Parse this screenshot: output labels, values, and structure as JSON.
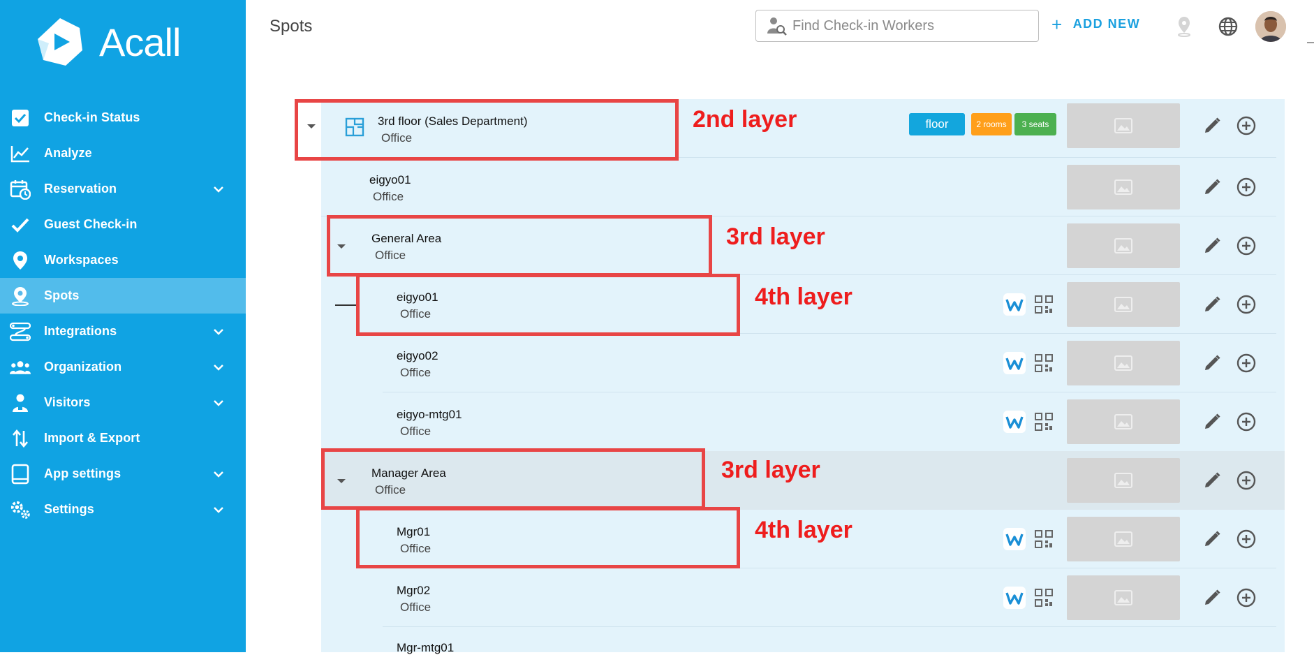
{
  "app": {
    "logo_text": "Acall"
  },
  "sidebar": {
    "items": [
      {
        "label": "Check-in Status",
        "icon": "checkbox-icon",
        "has_chevron": false,
        "active": false
      },
      {
        "label": "Analyze",
        "icon": "line-chart-icon",
        "has_chevron": false,
        "active": false
      },
      {
        "label": "Reservation",
        "icon": "calendar-clock-icon",
        "has_chevron": true,
        "active": false
      },
      {
        "label": "Guest Check-in",
        "icon": "checkmark-icon",
        "has_chevron": false,
        "active": false
      },
      {
        "label": "Workspaces",
        "icon": "map-pin-icon",
        "has_chevron": false,
        "active": false
      },
      {
        "label": "Spots",
        "icon": "spot-pin-icon",
        "has_chevron": false,
        "active": true
      },
      {
        "label": "Integrations",
        "icon": "integrations-icon",
        "has_chevron": true,
        "active": false
      },
      {
        "label": "Organization",
        "icon": "group-icon",
        "has_chevron": true,
        "active": false
      },
      {
        "label": "Visitors",
        "icon": "visitor-icon",
        "has_chevron": true,
        "active": false
      },
      {
        "label": "Import & Export",
        "icon": "import-export-icon",
        "has_chevron": false,
        "active": false
      },
      {
        "label": "App settings",
        "icon": "tablet-icon",
        "has_chevron": true,
        "active": false
      },
      {
        "label": "Settings",
        "icon": "gears-icon",
        "has_chevron": true,
        "active": false
      }
    ]
  },
  "header": {
    "title": "Spots",
    "search_placeholder": "Find Check-in Workers",
    "add_new_label": "ADD NEW"
  },
  "spots": {
    "rows": [
      {
        "title": "3rd floor (Sales Department)",
        "subtitle": "Office"
      },
      {
        "title": "eigyo01",
        "subtitle": "Office"
      },
      {
        "title": "General Area",
        "subtitle": "Office"
      },
      {
        "title": "eigyo01",
        "subtitle": "Office"
      },
      {
        "title": "eigyo02",
        "subtitle": "Office"
      },
      {
        "title": "eigyo-mtg01",
        "subtitle": "Office"
      },
      {
        "title": "Manager Area",
        "subtitle": "Office"
      },
      {
        "title": "Mgr01",
        "subtitle": "Office"
      },
      {
        "title": "Mgr02",
        "subtitle": "Office"
      },
      {
        "title": "Mgr-mtg01",
        "subtitle": ""
      }
    ],
    "badges": {
      "floor": "floor",
      "rooms": "2 rooms",
      "seats": "3 seats"
    }
  },
  "annotations": {
    "layer2": "2nd layer",
    "layer3_a": "3rd layer",
    "layer4_a": "4th layer",
    "layer3_b": "3rd layer",
    "layer4_b": "4th layer"
  },
  "colors": {
    "sidebar": "#10a3e3",
    "content_bg": "#e3f3fb",
    "annotation_red": "#e84545",
    "accent": "#1aa0df"
  }
}
